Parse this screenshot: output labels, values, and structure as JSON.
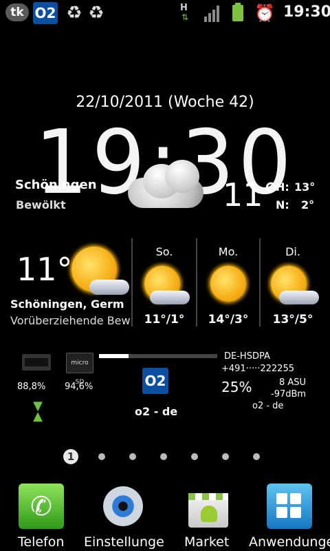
{
  "status_bar": {
    "notifications": [
      "tk",
      "O2",
      "recycle-icon",
      "recycle-icon"
    ],
    "network_type": "H",
    "time": "19:30"
  },
  "clock_widget": {
    "date": "22/10/2011 (Woche 42)",
    "time": "19:30",
    "location": "Schöningen",
    "condition": "Bewölkt",
    "temperature": "11°",
    "high_label": "H:",
    "high": "13°",
    "low_label": "N:",
    "low": "2°"
  },
  "weather_widget": {
    "current_temp": "11°",
    "location": "Schöningen, Germ",
    "condition": "Vorüberziehende Bew",
    "forecast": [
      {
        "day": "So.",
        "temp": "11°/1°"
      },
      {
        "day": "Mo.",
        "temp": "14°/3°"
      },
      {
        "day": "Di.",
        "temp": "13°/5°"
      }
    ]
  },
  "system_widget": {
    "ram_percent": "88,8%",
    "sd_percent": "94,6%",
    "sd_label": "micro SD",
    "network_type": "DE-HSDPA",
    "phone_number": "+491·····222255",
    "signal_percent": "25%",
    "asu": "8 ASU",
    "dbm": "-97dBm",
    "operator_small": "o2 - de",
    "operator": "o2 - de",
    "o2_logo": "O2",
    "progress": 0.25
  },
  "pager": {
    "current": "1",
    "count": 7
  },
  "dock": [
    {
      "label": "Telefon",
      "icon": "phone-icon"
    },
    {
      "label": "Einstellungen",
      "icon": "settings-icon"
    },
    {
      "label": "Market",
      "icon": "market-icon"
    },
    {
      "label": "Anwendungen",
      "icon": "apps-icon"
    }
  ],
  "colors": {
    "battery": "#7cc241",
    "o2": "#0b4fa3",
    "sun": "#f7b21b"
  }
}
